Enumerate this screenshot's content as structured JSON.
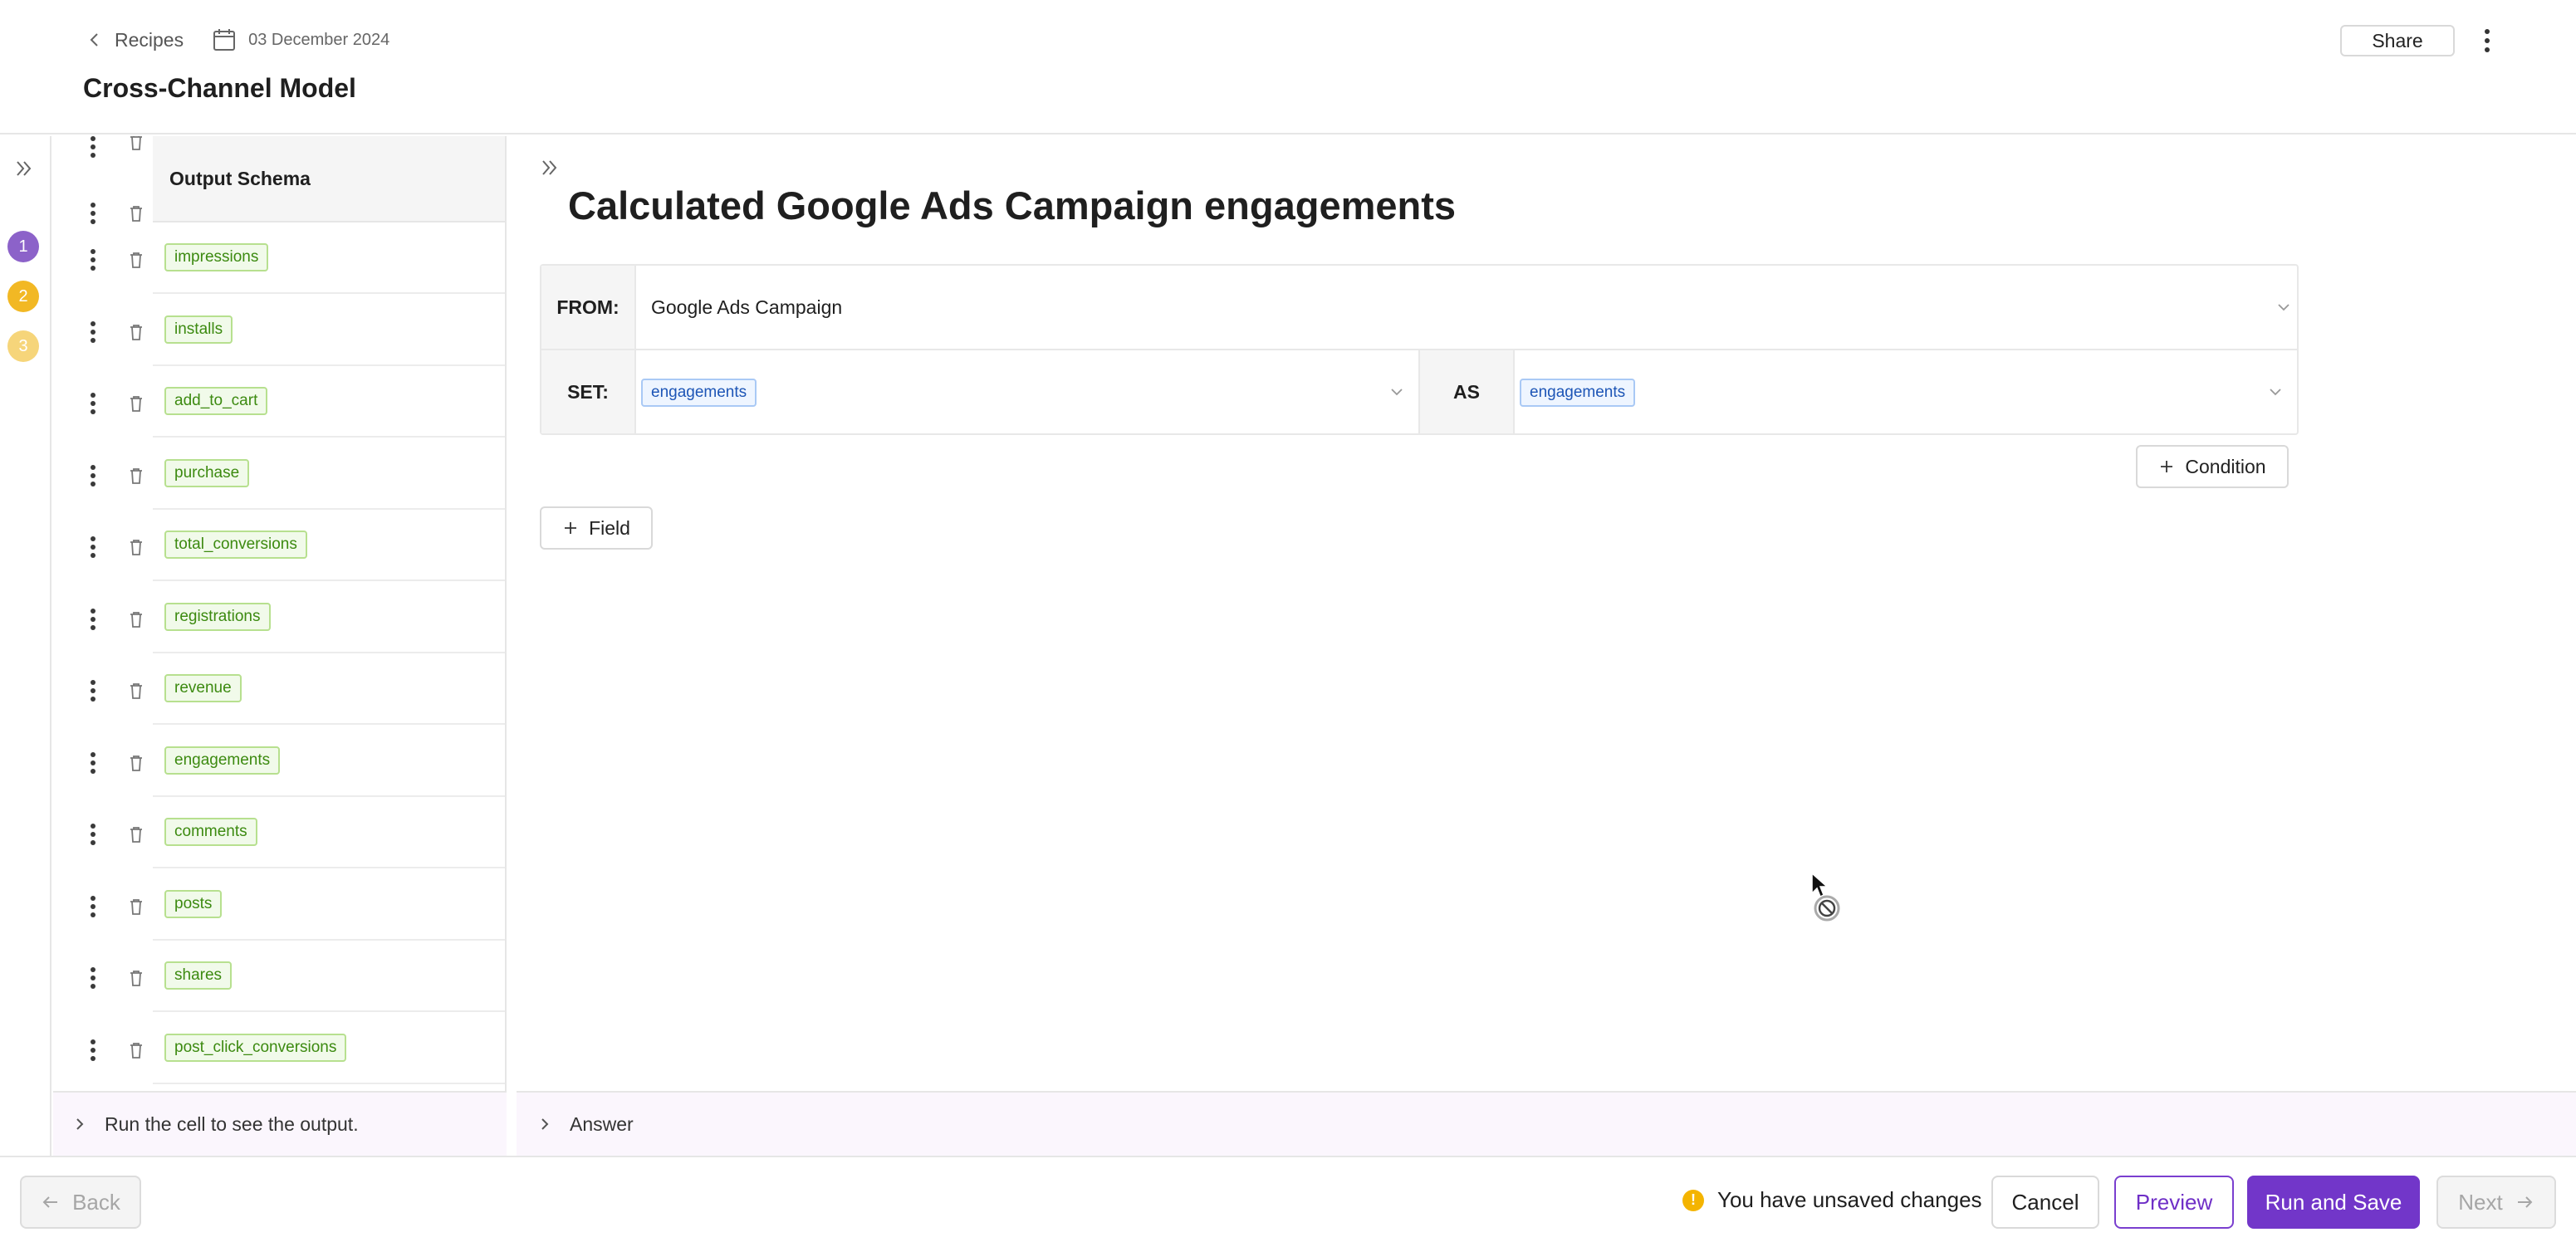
{
  "header": {
    "back_label": "Recipes",
    "date": "03 December 2024",
    "title": "Cross-Channel Model",
    "share_label": "Share"
  },
  "steps": [
    {
      "label": "1",
      "color": "#8c62c9"
    },
    {
      "label": "2",
      "color": "#f2b824"
    },
    {
      "label": "3",
      "color": "#f6d57a"
    }
  ],
  "schema": {
    "header": "Output Schema",
    "fields": [
      "impressions",
      "installs",
      "add_to_cart",
      "purchase",
      "total_conversions",
      "registrations",
      "revenue",
      "engagements",
      "comments",
      "posts",
      "shares",
      "post_click_conversions"
    ],
    "run_hint": "Run the cell to see the output."
  },
  "cell": {
    "title": "Calculated Google Ads Campaign engagements",
    "from_label": "FROM:",
    "from_value": "Google Ads Campaign",
    "set_label": "SET:",
    "set_value": "engagements",
    "as_label": "AS",
    "as_value": "engagements",
    "condition_label": "Condition",
    "field_label": "Field",
    "answer_label": "Answer"
  },
  "footer": {
    "back_label": "Back",
    "unsaved_text": "You have unsaved changes",
    "warn_symbol": "!",
    "cancel_label": "Cancel",
    "preview_label": "Preview",
    "run_save_label": "Run and Save",
    "next_label": "Next"
  },
  "colors": {
    "accent": "#7236c9",
    "tag_green": "#3c8a10",
    "tag_blue": "#1d55b6",
    "warning": "#f4b400"
  }
}
